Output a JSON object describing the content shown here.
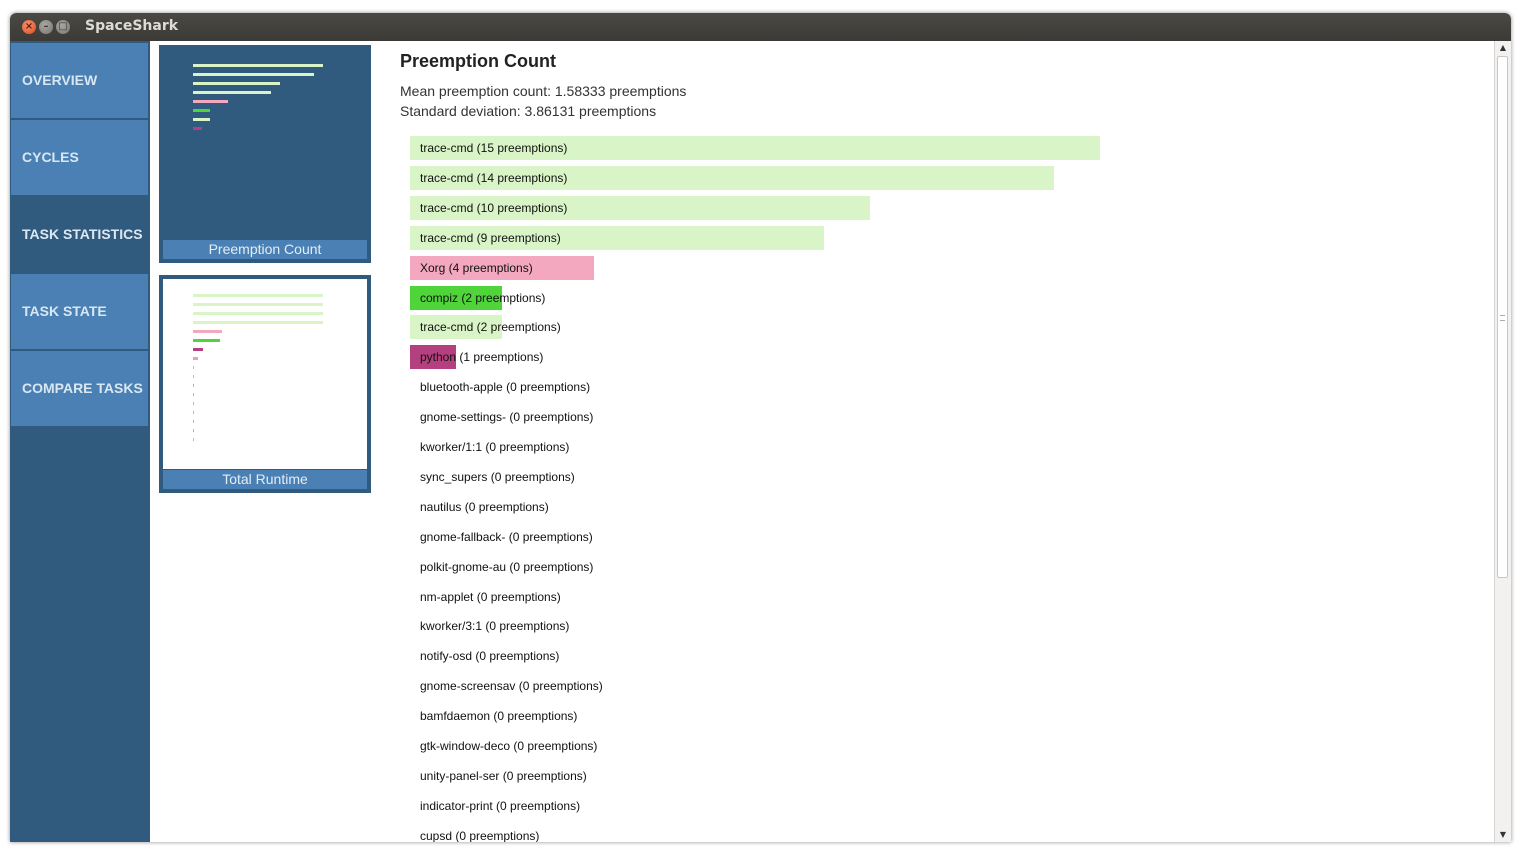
{
  "window": {
    "title": "SpaceShark",
    "close_glyph": "×",
    "min_glyph": "–",
    "max_glyph": "□"
  },
  "sidebar": {
    "items": [
      {
        "label": "OVERVIEW",
        "active": false
      },
      {
        "label": "CYCLES",
        "active": false
      },
      {
        "label": "TASK STATISTICS",
        "active": true
      },
      {
        "label": "TASK STATE",
        "active": false
      },
      {
        "label": "COMPARE TASKS",
        "active": false
      }
    ]
  },
  "thumbnails": [
    {
      "label": "Preemption Count",
      "selected": false
    },
    {
      "label": "Total Runtime",
      "selected": true
    }
  ],
  "main": {
    "title": "Preemption Count",
    "mean": "Mean preemption count: 1.58333 preemptions",
    "stddev": "Standard deviation: 3.86131 preemptions"
  },
  "colors": {
    "trace-cmd": "#d9f5c7",
    "Xorg": "#f4a8c0",
    "compiz": "#4fd43a",
    "python": "#b5407f",
    "sidebar_dark": "#315b7e",
    "sidebar_tab": "#4a80b3"
  },
  "chart_data": {
    "type": "bar",
    "title": "Preemption Count",
    "orientation": "horizontal",
    "unit": "preemptions",
    "bars": [
      {
        "label": "trace-cmd (15 preemptions)",
        "value": 15,
        "color": "#d9f5c7"
      },
      {
        "label": "trace-cmd (14 preemptions)",
        "value": 14,
        "color": "#d9f5c7"
      },
      {
        "label": "trace-cmd (10 preemptions)",
        "value": 10,
        "color": "#d9f5c7"
      },
      {
        "label": "trace-cmd (9 preemptions)",
        "value": 9,
        "color": "#d9f5c7"
      },
      {
        "label": "Xorg (4 preemptions)",
        "value": 4,
        "color": "#f4a8c0"
      },
      {
        "label": "compiz (2 preemptions)",
        "value": 2,
        "color": "#4fd43a"
      },
      {
        "label": "trace-cmd (2 preemptions)",
        "value": 2,
        "color": "#d9f5c7"
      },
      {
        "label": "python (1 preemptions)",
        "value": 1,
        "color": "#b5407f"
      },
      {
        "label": "bluetooth-apple (0 preemptions)",
        "value": 0,
        "color": "#d9f5c7"
      },
      {
        "label": "gnome-settings- (0 preemptions)",
        "value": 0,
        "color": "#d9f5c7"
      },
      {
        "label": "kworker/1:1 (0 preemptions)",
        "value": 0,
        "color": "#d9f5c7"
      },
      {
        "label": "sync_supers (0 preemptions)",
        "value": 0,
        "color": "#d9f5c7"
      },
      {
        "label": "nautilus (0 preemptions)",
        "value": 0,
        "color": "#d9f5c7"
      },
      {
        "label": "gnome-fallback- (0 preemptions)",
        "value": 0,
        "color": "#d9f5c7"
      },
      {
        "label": "polkit-gnome-au (0 preemptions)",
        "value": 0,
        "color": "#d9f5c7"
      },
      {
        "label": "nm-applet (0 preemptions)",
        "value": 0,
        "color": "#d9f5c7"
      },
      {
        "label": "kworker/3:1 (0 preemptions)",
        "value": 0,
        "color": "#d9f5c7"
      },
      {
        "label": "notify-osd (0 preemptions)",
        "value": 0,
        "color": "#d9f5c7"
      },
      {
        "label": "gnome-screensav (0 preemptions)",
        "value": 0,
        "color": "#d9f5c7"
      },
      {
        "label": "bamfdaemon (0 preemptions)",
        "value": 0,
        "color": "#d9f5c7"
      },
      {
        "label": "gtk-window-deco (0 preemptions)",
        "value": 0,
        "color": "#d9f5c7"
      },
      {
        "label": "unity-panel-ser (0 preemptions)",
        "value": 0,
        "color": "#d9f5c7"
      },
      {
        "label": "indicator-print (0 preemptions)",
        "value": 0,
        "color": "#d9f5c7"
      },
      {
        "label": "cupsd (0 preemptions)",
        "value": 0,
        "color": "#d9f5c7"
      }
    ]
  },
  "thumbnail_preemption_values": [
    15,
    14,
    10,
    9,
    4,
    2,
    2,
    1
  ],
  "thumbnail_runtime_values": [
    10,
    10,
    10,
    10,
    2.2,
    2.1,
    0.8,
    0.4,
    0.1,
    0.05,
    0.05,
    0.05,
    0.05,
    0.05,
    0.05,
    0.05,
    0.05
  ]
}
